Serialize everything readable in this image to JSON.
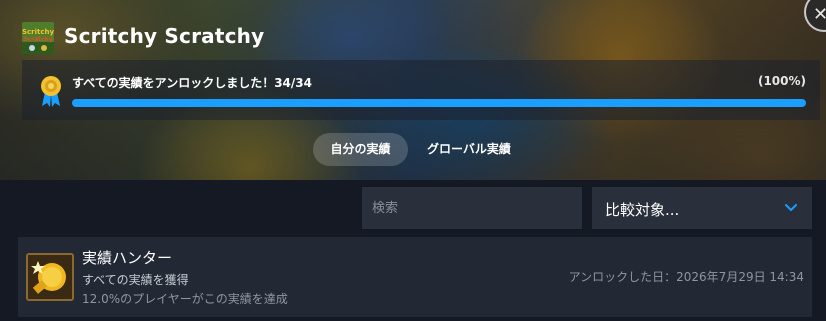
{
  "header": {
    "game_title": "Scritchy Scratchy",
    "game_icon": "game-cover-icon",
    "close_icon": "close-icon"
  },
  "progress": {
    "label": "すべての実績をアンロックしました！34/34",
    "percent_label": "(100%)",
    "unlocked": 34,
    "total": 34,
    "fraction": 1.0,
    "bar_color": "#1a9fff"
  },
  "tabs": [
    {
      "label": "自分の実績",
      "selected": true
    },
    {
      "label": "グローバル実績",
      "selected": false
    }
  ],
  "filters": {
    "search_placeholder": "検索",
    "search_value": "",
    "compare_label": "比較対象...",
    "compare_icon": "chevron-down-icon",
    "accent_color": "#1a9fff"
  },
  "achievements": [
    {
      "name": "実績ハンター",
      "description": "すべての実績を獲得",
      "rarity": "12.0%のプレイヤーがこの実績を達成",
      "unlocked_at": "アンロックした日：2026年7月29日 14:34",
      "icon": "gold-trophy-icon"
    }
  ]
}
